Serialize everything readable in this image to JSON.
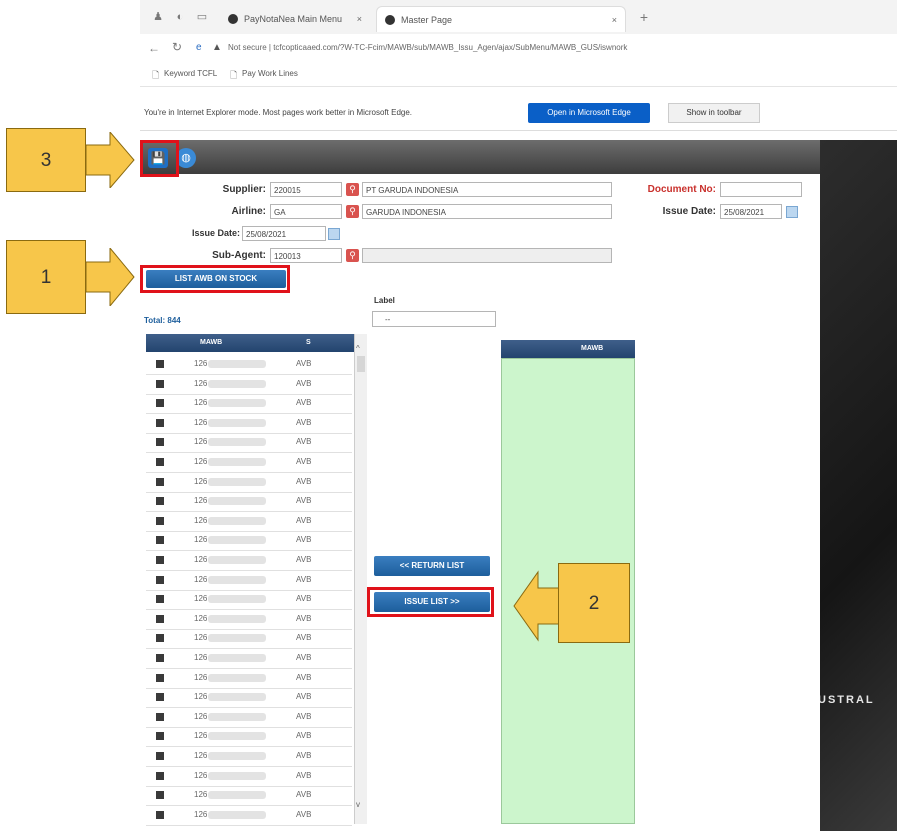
{
  "browser": {
    "tabs": [
      {
        "label": "PayNotaNea Main Menu"
      },
      {
        "label": "Master Page"
      }
    ],
    "address": "Not secure  |  tcfcopticaaed.com/?W-TC-Fcim/MAWB/sub/MAWB_Issu_Agen/ajax/SubMenu/MAWB_GUS/iswnork",
    "bookmarks": [
      "Keyword TCFL",
      "Pay Work Lines"
    ],
    "ie_notice": "You're in Internet Explorer mode. Most pages work better in Microsoft Edge.",
    "open_edge_label": "Open in Microsoft Edge",
    "show_toolbar_label": "Show in toolbar"
  },
  "form": {
    "supplier_label": "Supplier:",
    "supplier_code": "220015",
    "supplier_name": "PT GARUDA INDONESIA",
    "airline_label": "Airline:",
    "airline_code": "GA",
    "airline_name": "GARUDA INDONESIA",
    "issue_date_left_label": "Issue Date:",
    "issue_date_left": "25/08/2021",
    "subagent_label": "Sub-Agent:",
    "subagent_code": "120013",
    "document_label": "Document No:",
    "document_value": "",
    "issue_date_right_label": "Issue Date:",
    "issue_date_right": "25/08/2021",
    "list_button": "LIST AWB ON STOCK",
    "total_label": "Total: 844",
    "label_label": "Label",
    "label_select": "--",
    "return_button": "<< RETURN LIST",
    "issue_button": "ISSUE LIST >>"
  },
  "left_grid": {
    "headers": [
      "MAWB",
      "S"
    ],
    "rows": [
      {
        "mawb": "126",
        "status": "AVB"
      },
      {
        "mawb": "126",
        "status": "AVB"
      },
      {
        "mawb": "126",
        "status": "AVB"
      },
      {
        "mawb": "126",
        "status": "AVB"
      },
      {
        "mawb": "126",
        "status": "AVB"
      },
      {
        "mawb": "126",
        "status": "AVB"
      },
      {
        "mawb": "126",
        "status": "AVB"
      },
      {
        "mawb": "126",
        "status": "AVB"
      },
      {
        "mawb": "126",
        "status": "AVB"
      },
      {
        "mawb": "126",
        "status": "AVB"
      },
      {
        "mawb": "126",
        "status": "AVB"
      },
      {
        "mawb": "126",
        "status": "AVB"
      },
      {
        "mawb": "126",
        "status": "AVB"
      },
      {
        "mawb": "126",
        "status": "AVB"
      },
      {
        "mawb": "126",
        "status": "AVB"
      },
      {
        "mawb": "126",
        "status": "AVB"
      },
      {
        "mawb": "126",
        "status": "AVB"
      },
      {
        "mawb": "126",
        "status": "AVB"
      },
      {
        "mawb": "126",
        "status": "AVB"
      },
      {
        "mawb": "126",
        "status": "AVB"
      },
      {
        "mawb": "126",
        "status": "AVB"
      },
      {
        "mawb": "126",
        "status": "AVB"
      },
      {
        "mawb": "126",
        "status": "AVB"
      },
      {
        "mawb": "126",
        "status": "AVB"
      }
    ]
  },
  "right_grid": {
    "header": "MAWB"
  },
  "callouts": {
    "one": "1",
    "two": "2",
    "three": "3"
  },
  "map_text": "USTRAL",
  "colors": {
    "accent": "#1d5e9c",
    "highlight": "#e0121a",
    "callout": "#f7c64a",
    "issue_panel": "#ccf5cc"
  },
  "icons": [
    "save-icon",
    "globe-icon",
    "search-icon",
    "calendar-icon"
  ]
}
